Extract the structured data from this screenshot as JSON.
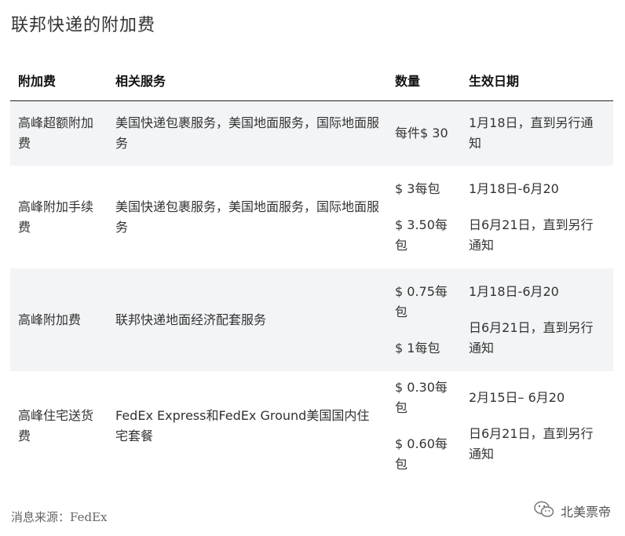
{
  "title": "联邦快递的附加费",
  "table": {
    "headers": [
      "附加费",
      "相关服务",
      "数量",
      "生效日期"
    ],
    "rows": [
      {
        "fee": "高峰超额附加费",
        "services": "美国快递包裹服务，美国地面服务，国际地面服务",
        "amounts": [
          "每件$ 30"
        ],
        "dates": [
          "1月18日，直到另行通知"
        ]
      },
      {
        "fee": "高峰附加手续费",
        "services": "美国快递包裹服务，美国地面服务，国际地面服务",
        "amounts": [
          "$ 3每包",
          "$ 3.50每包"
        ],
        "dates": [
          "1月18日-6月20",
          "日6月21日，直到另行通知"
        ]
      },
      {
        "fee": "高峰附加费",
        "services": "联邦快递地面经济配套服务",
        "amounts": [
          "$ 0.75每包",
          "$ 1每包"
        ],
        "dates": [
          "1月18日-6月20",
          "日6月21日，直到另行通知"
        ]
      },
      {
        "fee": "高峰住宅送货费",
        "services": "FedEx Express和FedEx Ground美国国内住宅套餐",
        "amounts": [
          "$ 0.30每包",
          "$ 0.60每包"
        ],
        "dates": [
          "2月15日– 6月20",
          "日6月21日，直到另行通知"
        ]
      }
    ]
  },
  "source": "消息来源：FedEx",
  "brand": {
    "icon": "wechat-icon",
    "name": "北美票帝"
  }
}
